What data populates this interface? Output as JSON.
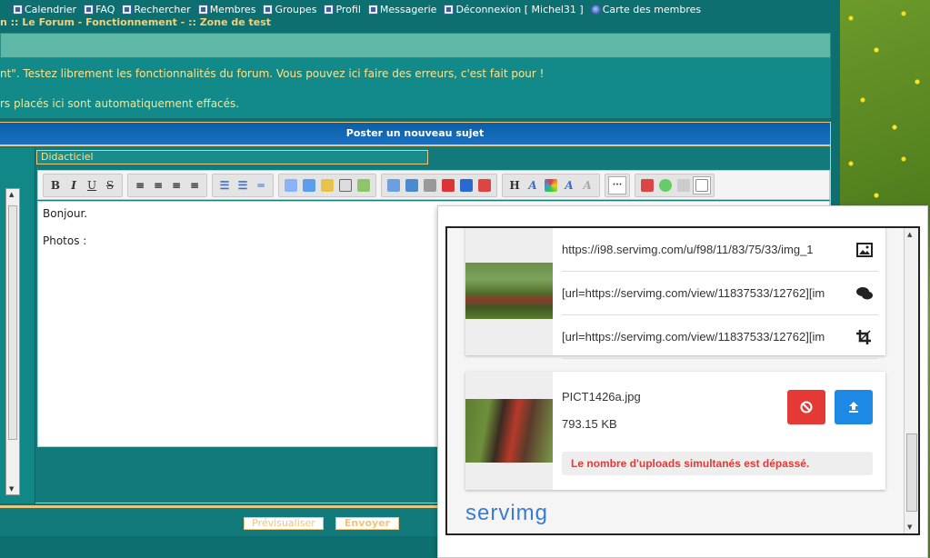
{
  "nav": {
    "items": [
      {
        "label": "Calendrier"
      },
      {
        "label": "FAQ"
      },
      {
        "label": "Rechercher"
      },
      {
        "label": "Membres"
      },
      {
        "label": "Groupes"
      },
      {
        "label": "Profil"
      },
      {
        "label": "Messagerie"
      },
      {
        "label": "Déconnexion [ Michel31 ]"
      },
      {
        "label": "Carte des membres"
      }
    ],
    "breadcrumb": "n  :: Le Forum - Fonctionnement - :: Zone de test"
  },
  "notice": {
    "line1": "nt\". Testez librement les fonctionnalités du forum. Vous pouvez ici faire des erreurs, c'est fait pour !",
    "line2": "rs placés ici sont automatiquement effacés."
  },
  "form": {
    "header": "Poster un nouveau sujet",
    "subject_value": "Didacticiel",
    "toolbar": {
      "bold": "B",
      "italic": "I",
      "underline": "U",
      "strike": "S",
      "heading": "H",
      "font": "A"
    },
    "editor": {
      "line1": "Bonjour.",
      "line2": "Photos :"
    },
    "preview_label": "Prévisualiser",
    "send_label": "Envoyer"
  },
  "servimg": {
    "links": [
      {
        "text": "https://i98.servimg.com/u/f98/11/83/75/33/img_1",
        "icon": "image-icon"
      },
      {
        "text": "[url=https://servimg.com/view/11837533/12762][im",
        "icon": "comments-icon"
      },
      {
        "text": "[url=https://servimg.com/view/11837533/12762][im",
        "icon": "crop-icon"
      }
    ],
    "file": {
      "name": "PICT1426a.jpg",
      "size": "793.15 KB"
    },
    "error": "Le nombre d'uploads simultanés est dépassé.",
    "logo": "servimg"
  },
  "colors": {
    "accent_blue": "#1e88e5",
    "cancel_red": "#e53935",
    "forum_teal": "#0d6f6f",
    "notice_yellow": "#ffe38a"
  }
}
